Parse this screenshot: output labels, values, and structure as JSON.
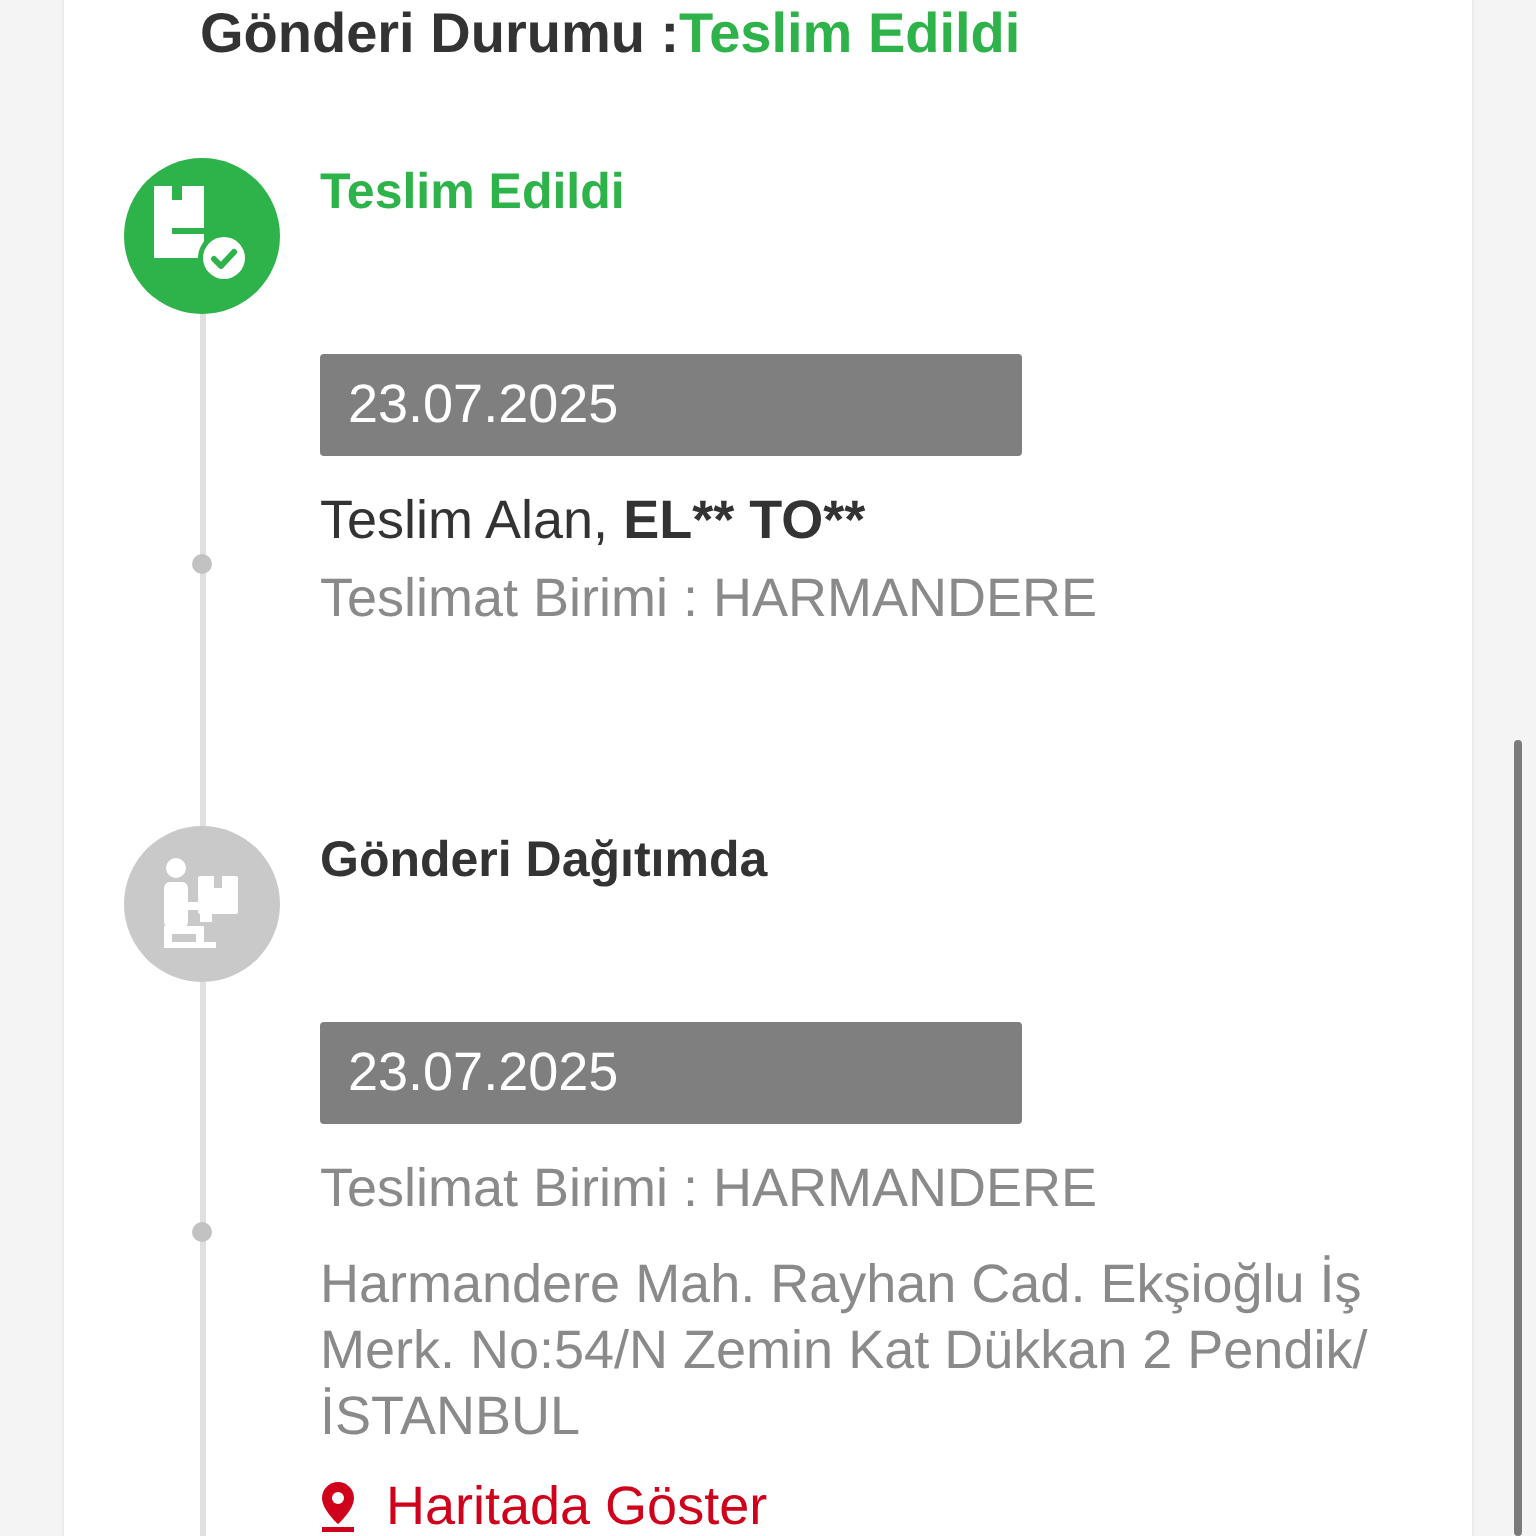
{
  "header": {
    "label": "Gönderi Durumu :",
    "status": "Teslim Edildi"
  },
  "steps": [
    {
      "kind": "delivered",
      "active": true,
      "title": "Teslim Edildi",
      "date": "23.07.2025",
      "details": [
        {
          "kind": "recipient",
          "label": "Teslim Alan,",
          "name": "EL** TO**"
        },
        {
          "kind": "unit",
          "text": "Teslimat Birimi : HARMANDERE"
        }
      ]
    },
    {
      "kind": "out_for_delivery",
      "active": false,
      "title": "Gönderi Dağıtımda",
      "date": "23.07.2025",
      "details": [
        {
          "kind": "unit",
          "text": "Teslimat Birimi : HARMANDERE"
        },
        {
          "kind": "address",
          "text": "Harmandere Mah. Rayhan Cad. Ekşioğlu İş Merk. No:54/N Zemin Kat Dükkan 2 Pendik/İSTANBUL"
        },
        {
          "kind": "map_link",
          "text": "Haritada Göster"
        }
      ]
    }
  ]
}
